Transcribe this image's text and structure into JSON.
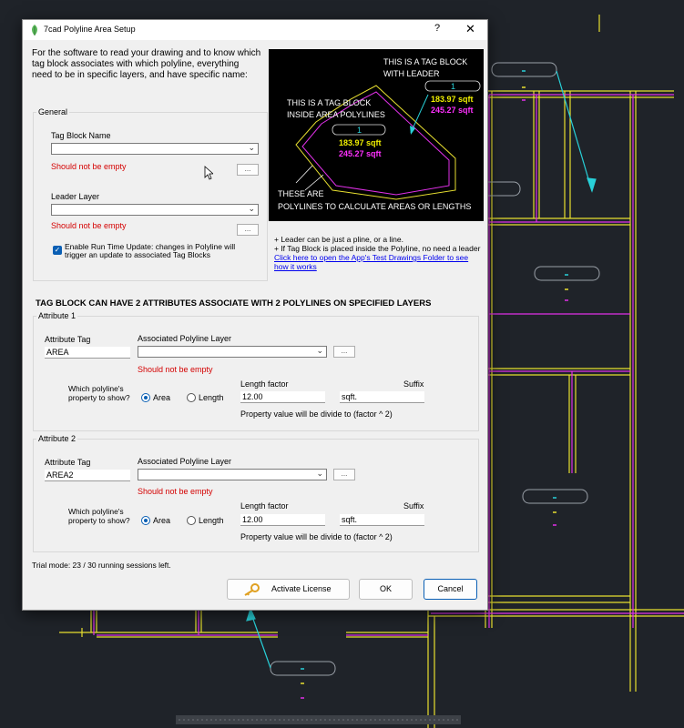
{
  "window": {
    "title": "7cad Polyline Area Setup",
    "help_label": "?",
    "close_label": "✕"
  },
  "intro": "For the software to read your drawing and to know which tag block associates with which polyline, everything need to be in specific layers, and have specific name:",
  "preview": {
    "leader_caption_1": "THIS IS A TAG BLOCK",
    "leader_caption_2": "WITH LEADER",
    "inside_caption_1": "THIS IS A TAG BLOCK",
    "inside_caption_2": "INSIDE AREA POLYLINES",
    "tag_id_top": "1",
    "tag_id_center": "1",
    "area_sqft": "183.97 sqft",
    "length_sqft": "245.27 sqft",
    "bottom_caption_1": "THESE ARE",
    "bottom_caption_2": "POLYLINES TO CALCULATE AREAS OR LENGTHS"
  },
  "general": {
    "label": "General",
    "tag_block_label": "Tag Block Name",
    "tag_block_value": "",
    "tag_block_error": "Should not be empty",
    "leader_layer_label": "Leader Layer",
    "leader_layer_value": "",
    "leader_layer_error": "Should not be empty",
    "browse_label": "...",
    "runtime_checkbox_label": "Enable Run Time Update: changes in Polyline will trigger an update to associated Tag Blocks",
    "runtime_checked": true
  },
  "notes": {
    "line1": "+ Leader can be just a pline, or a line.",
    "line2": "+ If Tag Block is placed inside the Polyline, no need a leader",
    "link": "Click here to open the App's Test Drawings Folder to see how it works"
  },
  "section_title": "TAG BLOCK CAN HAVE 2 ATTRIBUTES ASSOCIATE WITH 2 POLYLINES ON SPECIFIED LAYERS",
  "attributes": [
    {
      "label": "Attribute 1",
      "tag_label": "Attribute Tag",
      "tag_value": "AREA",
      "layer_label": "Associated Polyline Layer",
      "layer_value": "",
      "layer_error": "Should not be empty",
      "browse_label": "...",
      "property_question": "Which polyline's property to show?",
      "option_area": "Area",
      "option_length": "Length",
      "selected": "Area",
      "factor_label": "Length factor",
      "factor_value": "12.00",
      "suffix_label": "Suffix",
      "suffix_value": "sqft.",
      "divide_note": "Property value will be divide to (factor ^ 2)"
    },
    {
      "label": "Attribute 2",
      "tag_label": "Attribute Tag",
      "tag_value": "AREA2",
      "layer_label": "Associated Polyline Layer",
      "layer_value": "",
      "layer_error": "Should not be empty",
      "browse_label": "...",
      "property_question": "Which polyline's property to show?",
      "option_area": "Area",
      "option_length": "Length",
      "selected": "Area",
      "factor_label": "Length factor",
      "factor_value": "12.00",
      "suffix_label": "Suffix",
      "suffix_value": "sqft.",
      "divide_note": "Property value will be divide to (factor ^ 2)"
    }
  ],
  "trial_text": "Trial mode: 23 / 30 running sessions left.",
  "buttons": {
    "activate": "Activate License",
    "ok": "OK",
    "cancel": "Cancel"
  },
  "colors": {
    "cad_bg": "#1f2329",
    "wall_yellow": "#e8e030",
    "wall_magenta": "#e030e8",
    "leader_cyan": "#28d0d8",
    "preview_yellow": "#f0f000",
    "preview_magenta": "#ff30ff",
    "error_red": "#d40000",
    "accent_blue": "#0a5fb4"
  }
}
